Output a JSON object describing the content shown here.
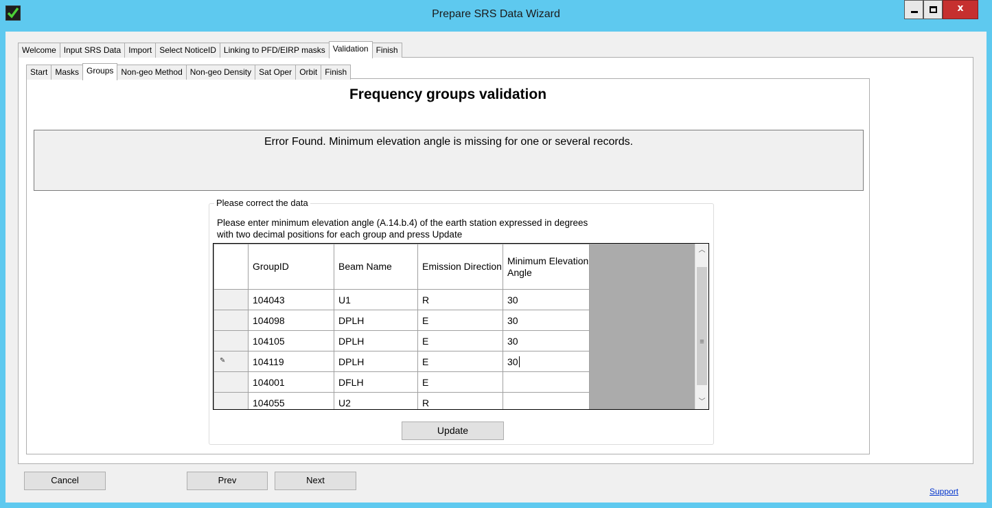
{
  "window": {
    "title": "Prepare SRS Data Wizard",
    "close_glyph": "x"
  },
  "outer_tabs": [
    "Welcome",
    "Input SRS Data",
    "Import",
    "Select NoticeID",
    "Linking to PFD/EIRP masks",
    "Validation",
    "Finish"
  ],
  "inner_tabs": [
    "Start",
    "Masks",
    "Groups",
    "Non-geo Method",
    "Non-geo Density",
    "Sat Oper",
    "Orbit",
    "Finish"
  ],
  "page": {
    "heading": "Frequency groups validation",
    "error": "Error Found. Minimum elevation angle is missing for one or several records."
  },
  "group": {
    "label": "Please correct the data",
    "instruction_line1": "Please enter minimum elevation angle (A.14.b.4) of the earth station expressed in degrees",
    "instruction_line2": "with two decimal positions for each group and press Update"
  },
  "grid": {
    "headers": {
      "group_id": "GroupID",
      "beam_name": "Beam Name",
      "emission_direction": "Emission Direction",
      "min_elevation": "Minimum Elevation Angle"
    },
    "rows": [
      {
        "group_id": "104043",
        "beam_name": "U1",
        "emission_direction": "R",
        "min_elevation": "30"
      },
      {
        "group_id": "104098",
        "beam_name": "DPLH",
        "emission_direction": "E",
        "min_elevation": "30"
      },
      {
        "group_id": "104105",
        "beam_name": "DPLH",
        "emission_direction": "E",
        "min_elevation": "30"
      },
      {
        "group_id": "104119",
        "beam_name": "DPLH",
        "emission_direction": "E",
        "min_elevation": "30"
      },
      {
        "group_id": "104001",
        "beam_name": "DFLH",
        "emission_direction": "E",
        "min_elevation": ""
      },
      {
        "group_id": "104055",
        "beam_name": "U2",
        "emission_direction": "R",
        "min_elevation": ""
      }
    ]
  },
  "buttons": {
    "update": "Update",
    "cancel": "Cancel",
    "prev": "Prev",
    "next": "Next"
  },
  "support_link": "Support",
  "icons": {
    "app": "checkmark-icon",
    "edit_row": "pencil-icon"
  },
  "colors": {
    "titlebar": "#5ec9ef",
    "close": "#c6302f",
    "link": "#0033cc"
  }
}
